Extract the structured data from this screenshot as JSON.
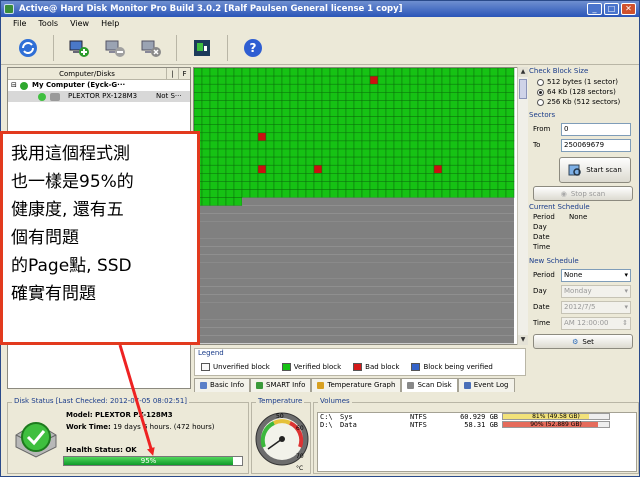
{
  "window": {
    "title": "Active@ Hard Disk Monitor Pro Build 3.0.2 [Ralf Paulsen General license 1 copy]",
    "controls": [
      "_",
      "□",
      "✕"
    ]
  },
  "menu": [
    "File",
    "Tools",
    "View",
    "Help"
  ],
  "toolbar": {
    "buttons": [
      "refresh-icon",
      "add-computer-icon",
      "remove-computer-icon",
      "computer-disconnect-icon",
      "scan-icon",
      "help-icon"
    ]
  },
  "left_pane": {
    "header": {
      "col1": "Computer/Disks",
      "col2": "|",
      "col3": "F"
    },
    "tree": {
      "root": "My Computer (Eyck-G···",
      "child": "PLEXTOR PX-128M3",
      "child_status": "Not S···"
    }
  },
  "grid": {
    "cols": 40,
    "rows_total": 34,
    "verified_rows": 17,
    "last_verified_cols": 6,
    "bad_blocks": [
      [
        1,
        22
      ],
      [
        8,
        8
      ],
      [
        12,
        8
      ],
      [
        12,
        15
      ],
      [
        12,
        30
      ]
    ],
    "colors": {
      "verified": "#16c214",
      "unverified": "#808080",
      "bad": "#cc1010",
      "line": "#0a6f0a"
    }
  },
  "legend": {
    "title": "Legend",
    "items": [
      {
        "label": "Unverified block",
        "color": "#f8f8f8"
      },
      {
        "label": "Verified block",
        "color": "#16c214"
      },
      {
        "label": "Bad block",
        "color": "#d51a1a"
      },
      {
        "label": "Block being verified",
        "color": "#3563c9"
      }
    ]
  },
  "tabs": [
    "Basic Info",
    "SMART Info",
    "Temperature Graph",
    "Scan Disk",
    "Event Log"
  ],
  "right_panel": {
    "check_block_title": "Check Block Size",
    "block_options": [
      "512 bytes (1 sector)",
      "64 Kb (128 sectors)",
      "256 Kb (512 sectors)"
    ],
    "selected_block": 1,
    "sectors_title": "Sectors",
    "from_label": "From",
    "from_value": "0",
    "to_label": "To",
    "to_value": "250069679",
    "start_scan": "Start scan",
    "stop_scan": "Stop scan",
    "current_schedule_title": "Current Schedule",
    "current_schedule": [
      {
        "k": "Period",
        "v": "None"
      },
      {
        "k": "Day",
        "v": ""
      },
      {
        "k": "Date",
        "v": ""
      },
      {
        "k": "Time",
        "v": ""
      }
    ],
    "new_schedule_title": "New Schedule",
    "new_schedule": {
      "period_label": "Period",
      "period_value": "None",
      "day_label": "Day",
      "day_value": "Monday",
      "date_label": "Date",
      "date_value": "2012/7/5",
      "time_label": "Time",
      "time_value": "AM 12:00:00"
    },
    "set_button": "Set"
  },
  "disk_status": {
    "title": "Disk Status [Last Checked: 2012-07-05 08:02:51]",
    "model_label": "Model:",
    "model_value": "PLEXTOR PX-128M3",
    "work_label": "Work Time:",
    "work_value": "19 days 6 hours. (472 hours)",
    "health_label": "Health Status: OK",
    "health_percent_text": "95%",
    "health_percent": 95
  },
  "temperature": {
    "title": "Temperature",
    "unit": "°C",
    "ticks": [
      "50",
      "60",
      "70"
    ]
  },
  "volumes": {
    "title": "Volumes",
    "rows": [
      {
        "drive": "C:\\",
        "name": "Sys",
        "fs": "NTFS",
        "size": "60.929 GB",
        "usage_text": "81% (49.58 GB)",
        "usage": 81,
        "color": "#f2e27a"
      },
      {
        "drive": "D:\\",
        "name": "Data",
        "fs": "NTFS",
        "size": "58.31 GB",
        "usage_text": "90% (52.889 GB)",
        "usage": 90,
        "color": "#e56b5b"
      }
    ]
  },
  "callout": {
    "lines": [
      "我用這個程式測",
      "也一樣是95%的",
      "健康度, 還有五",
      "個有問題",
      "的Page點, SSD",
      "確實有問題"
    ]
  }
}
